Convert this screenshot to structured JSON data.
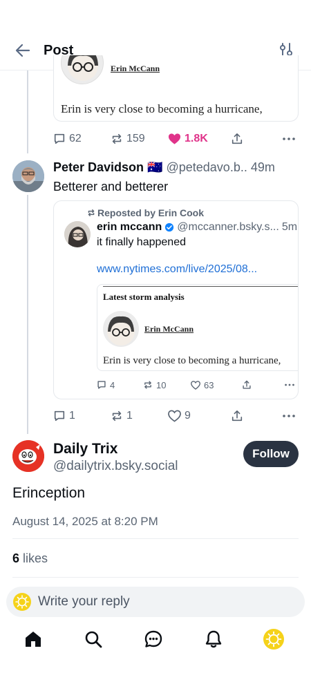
{
  "header": {
    "title": "Post"
  },
  "top_post": {
    "card_byline": "Erin McCann",
    "card_headline": "Erin is very close to becoming a hurricane,",
    "replies": "62",
    "reposts": "159",
    "likes": "1.8K"
  },
  "reply_post": {
    "author_name": "Peter Davidson 🇦🇺",
    "author_handle": "@petedavo.b..",
    "time": "49m",
    "text": "Betterer and betterer",
    "quote": {
      "repost_label": "Reposted by Erin Cook",
      "author_name": "erin mccann",
      "author_handle": "@mccanner.bsky.s...",
      "time": "5m",
      "text": "it finally happened",
      "link": "www.nytimes.com/live/2025/08...",
      "embed_title": "Latest storm analysis",
      "embed_byline": "Erin McCann",
      "embed_headline": "Erin is very close to becoming a hurricane,",
      "replies": "4",
      "reposts": "10",
      "likes": "63"
    },
    "replies": "1",
    "reposts": "1",
    "likes": "9"
  },
  "main_post": {
    "author_name": "Daily Trix",
    "author_handle": "@dailytrix.bsky.social",
    "follow_label": "Follow",
    "text": "Erinception",
    "timestamp": "August 14, 2025 at 8:20 PM",
    "likes_count": "6",
    "likes_label": "likes"
  },
  "reply_input": {
    "placeholder": "Write your reply"
  },
  "tabs": [
    "home-icon",
    "search-icon",
    "chat-icon",
    "bell-icon",
    "profile-icon"
  ],
  "colors": {
    "like": "#e0338a",
    "link": "#1f6fd6",
    "follow_bg": "#2a3342",
    "muted": "#5a6573",
    "verified": "#1083fe"
  }
}
